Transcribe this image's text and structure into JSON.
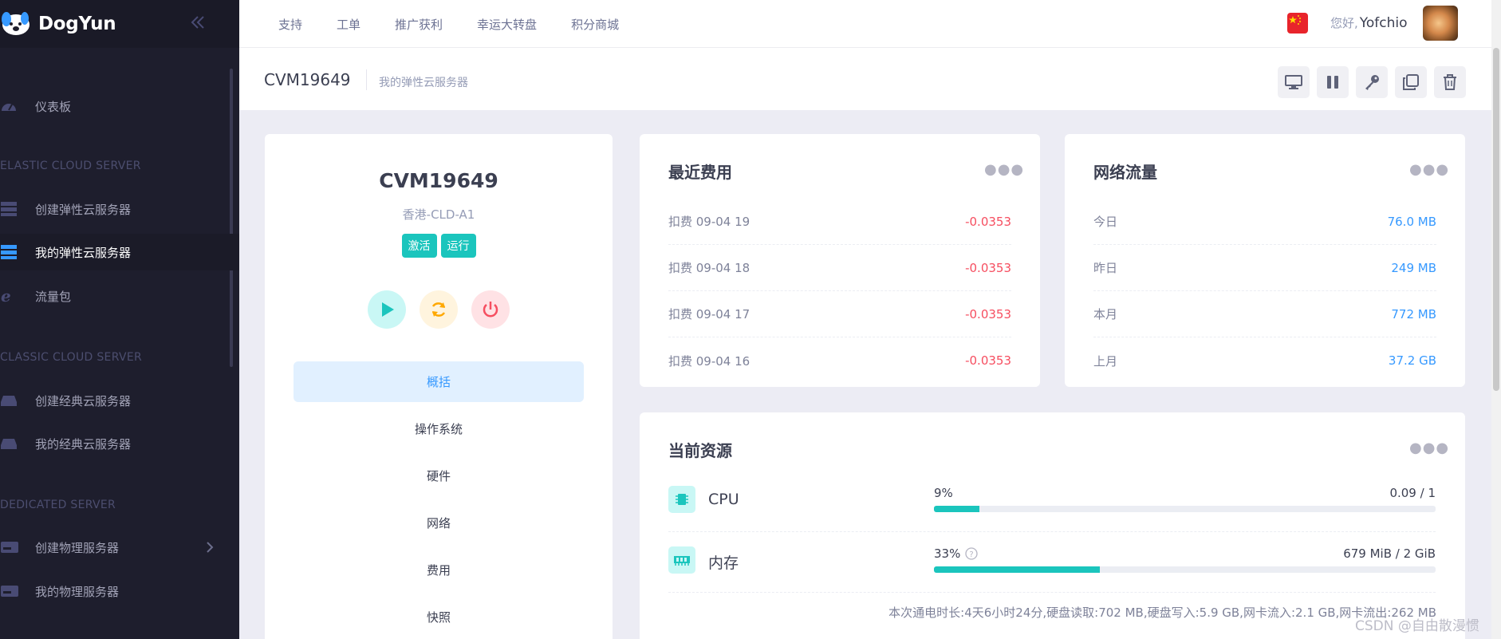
{
  "app": {
    "logo_text": "DogYun"
  },
  "sidebar": {
    "dashboard": "仪表板",
    "sections": [
      "ELASTIC CLOUD SERVER",
      "CLASSIC CLOUD SERVER",
      "DEDICATED SERVER"
    ],
    "items": [
      {
        "label": "创建弹性云服务器"
      },
      {
        "label": "我的弹性云服务器"
      },
      {
        "label": "流量包"
      },
      {
        "label": "创建经典云服务器"
      },
      {
        "label": "我的经典云服务器"
      },
      {
        "label": "创建物理服务器"
      },
      {
        "label": "我的物理服务器"
      }
    ]
  },
  "topnav": [
    "支持",
    "工单",
    "推广获利",
    "幸运大转盘",
    "积分商城"
  ],
  "user": {
    "greeting": "您好,",
    "name": "Yofchio"
  },
  "subheader": {
    "title": "CVM19649",
    "desc": "我的弹性云服务器"
  },
  "vm": {
    "name": "CVM19649",
    "region": "香港-CLD-A1",
    "badges": [
      "激活",
      "运行"
    ],
    "menu": [
      "概括",
      "操作系统",
      "硬件",
      "网络",
      "费用",
      "快照"
    ]
  },
  "fees": {
    "title": "最近费用",
    "rows": [
      {
        "k": "扣费 09-04 19",
        "v": "-0.0353"
      },
      {
        "k": "扣费 09-04 18",
        "v": "-0.0353"
      },
      {
        "k": "扣费 09-04 17",
        "v": "-0.0353"
      },
      {
        "k": "扣费 09-04 16",
        "v": "-0.0353"
      }
    ]
  },
  "traffic": {
    "title": "网络流量",
    "rows": [
      {
        "k": "今日",
        "v": "76.0 MB"
      },
      {
        "k": "昨日",
        "v": "249 MB"
      },
      {
        "k": "本月",
        "v": "772 MB"
      },
      {
        "k": "上月",
        "v": "37.2 GB"
      }
    ]
  },
  "resources": {
    "title": "当前资源",
    "cpu": {
      "name": "CPU",
      "pct": "9%",
      "value": "0.09 / 1",
      "fill": 0.09
    },
    "mem": {
      "name": "内存",
      "pct": "33%",
      "value": "679 MiB / 2 GiB",
      "fill": 0.33
    },
    "footnote": "本次通电时长:4天6小时24分,硬盘读取:702 MB,硬盘写入:5.9 GB,网卡流入:2.1 GB,网卡流出:262 MB"
  },
  "colors": {
    "accent": "#1bc5bd",
    "danger": "#f64e60",
    "link": "#3699ff",
    "sidebar_bg": "#1e1e2d"
  },
  "watermark": "CSDN @自由散漫惯"
}
